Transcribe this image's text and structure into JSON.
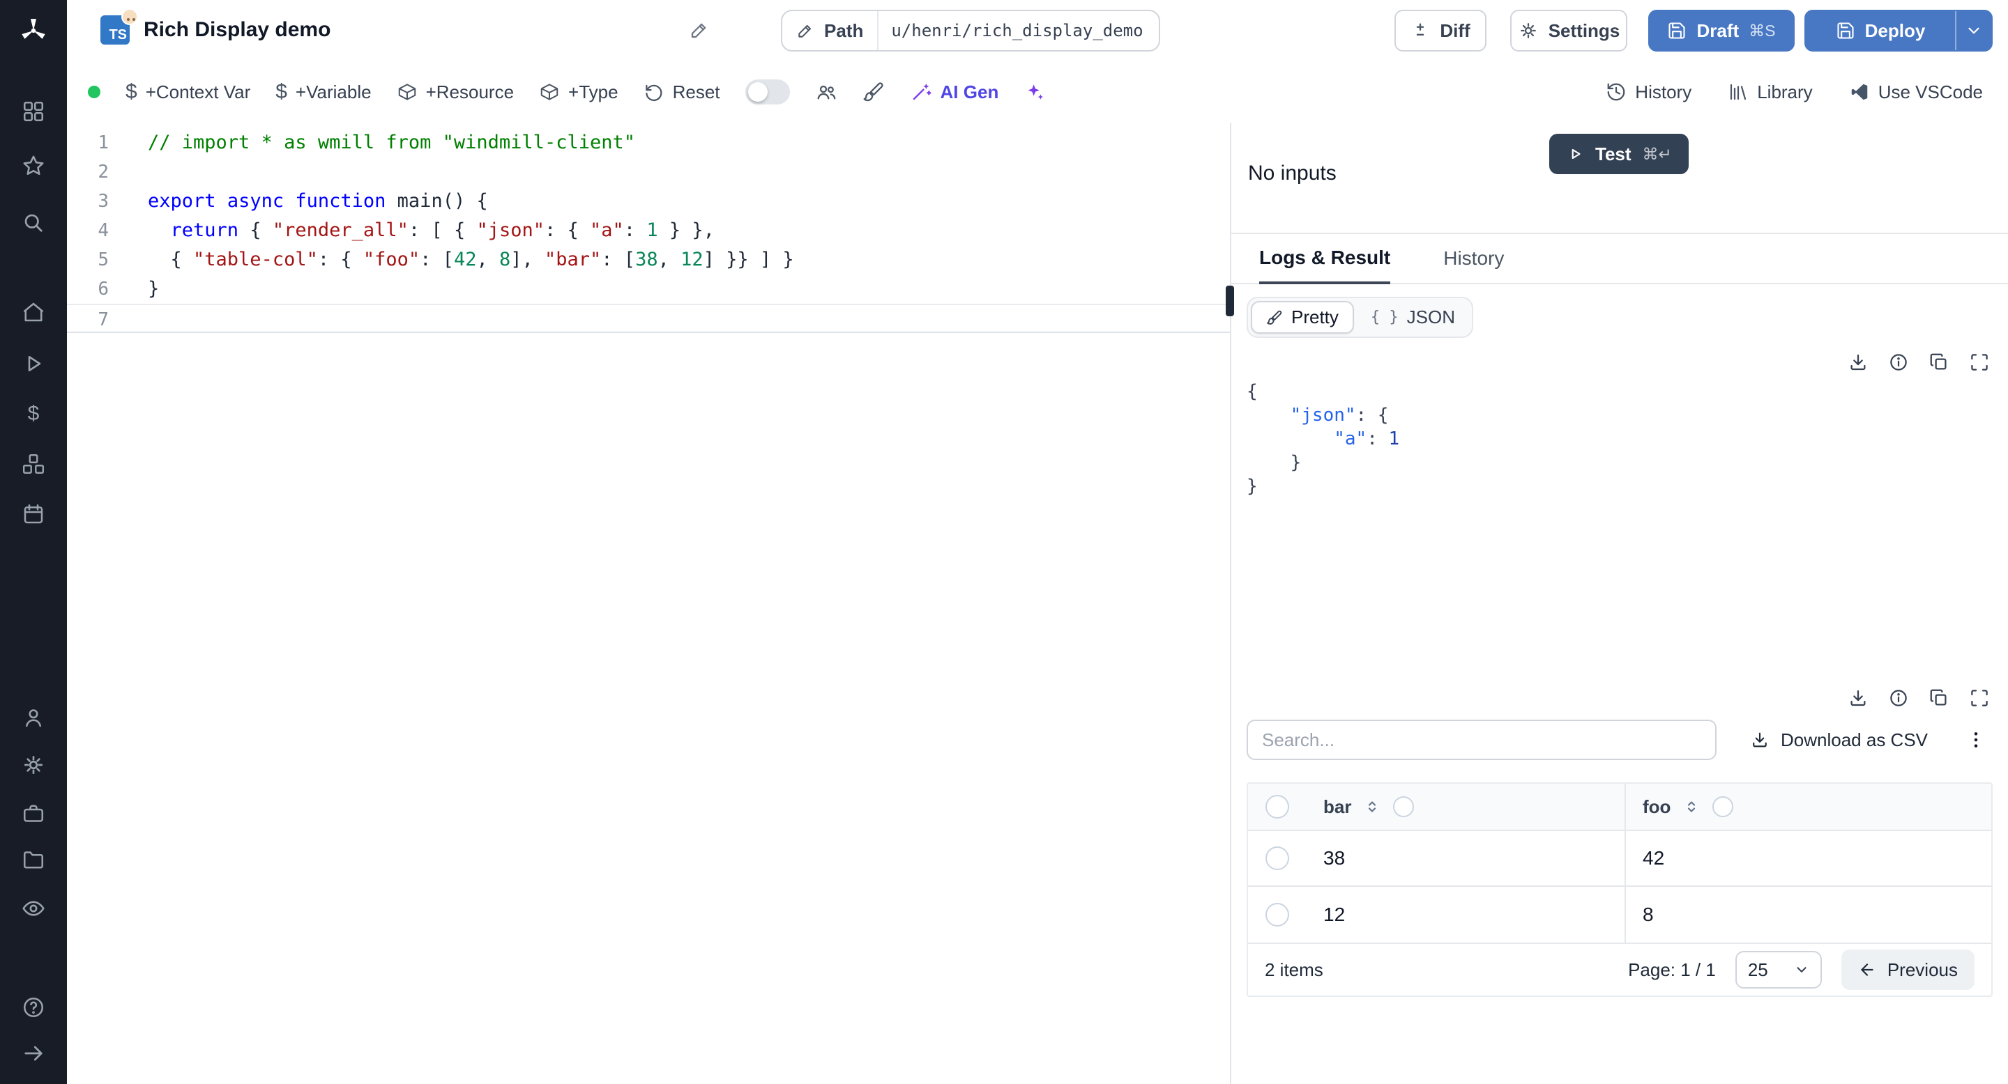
{
  "colors": {
    "primary_button": "#4878c4",
    "sidebar_bg": "#171c26",
    "status_dot": "#22c55e",
    "ai_accent": "#7c3aed",
    "ts_badge": "#3178c6",
    "test_button": "#334155"
  },
  "sidebar": {
    "icons": [
      "windmill-logo",
      "workspace-apps",
      "favorites-star",
      "search",
      "home",
      "runs-play",
      "variables-dollar",
      "resources-boxes",
      "schedules-calendar",
      "users",
      "settings-gear",
      "workers-briefcase",
      "folders",
      "audit-eye",
      "help",
      "collapse-arrow"
    ]
  },
  "header": {
    "language_badge": "TS",
    "title": "Rich Display demo",
    "path_button": "Path",
    "path_value": "u/henri/rich_display_demo",
    "diff_button": "Diff",
    "settings_button": "Settings",
    "draft_button": "Draft",
    "draft_shortcut": "⌘S",
    "deploy_button": "Deploy"
  },
  "toolbar": {
    "context_var": "+Context Var",
    "variable": "+Variable",
    "resource": "+Resource",
    "type": "+Type",
    "reset": "Reset",
    "ai_gen": "AI Gen",
    "history": "History",
    "library": "Library",
    "vscode": "Use VSCode"
  },
  "editor": {
    "lines": [
      {
        "n": 1,
        "parts": [
          {
            "t": "// import * as wmill from \"windmill-client\"",
            "c": "comment"
          }
        ]
      },
      {
        "n": 2,
        "parts": []
      },
      {
        "n": 3,
        "parts": [
          {
            "t": "export",
            "c": "kw"
          },
          {
            "t": " ",
            "c": "pln"
          },
          {
            "t": "async",
            "c": "kw"
          },
          {
            "t": " ",
            "c": "pln"
          },
          {
            "t": "function",
            "c": "kw"
          },
          {
            "t": " ",
            "c": "pln"
          },
          {
            "t": "main",
            "c": "fn"
          },
          {
            "t": "() {",
            "c": "pln"
          }
        ]
      },
      {
        "n": 4,
        "parts": [
          {
            "t": "  ",
            "c": "pln"
          },
          {
            "t": "return",
            "c": "kw"
          },
          {
            "t": " { ",
            "c": "pln"
          },
          {
            "t": "\"render_all\"",
            "c": "str"
          },
          {
            "t": ": [ { ",
            "c": "pln"
          },
          {
            "t": "\"json\"",
            "c": "str"
          },
          {
            "t": ": { ",
            "c": "pln"
          },
          {
            "t": "\"a\"",
            "c": "str"
          },
          {
            "t": ": ",
            "c": "pln"
          },
          {
            "t": "1",
            "c": "num"
          },
          {
            "t": " } },",
            "c": "pln"
          }
        ]
      },
      {
        "n": 5,
        "parts": [
          {
            "t": "  { ",
            "c": "pln"
          },
          {
            "t": "\"table-col\"",
            "c": "str"
          },
          {
            "t": ": { ",
            "c": "pln"
          },
          {
            "t": "\"foo\"",
            "c": "str"
          },
          {
            "t": ": [",
            "c": "pln"
          },
          {
            "t": "42",
            "c": "num"
          },
          {
            "t": ", ",
            "c": "pln"
          },
          {
            "t": "8",
            "c": "num"
          },
          {
            "t": "], ",
            "c": "pln"
          },
          {
            "t": "\"bar\"",
            "c": "str"
          },
          {
            "t": ": [",
            "c": "pln"
          },
          {
            "t": "38",
            "c": "num"
          },
          {
            "t": ", ",
            "c": "pln"
          },
          {
            "t": "12",
            "c": "num"
          },
          {
            "t": "] }} ] }",
            "c": "pln"
          }
        ]
      },
      {
        "n": 6,
        "parts": [
          {
            "t": "}",
            "c": "pln"
          }
        ]
      },
      {
        "n": 7,
        "parts": [],
        "current": true
      }
    ]
  },
  "preview": {
    "no_inputs": "No inputs",
    "test_button": "Test",
    "test_shortcut": "⌘↵",
    "tabs": [
      {
        "label": "Logs & Result",
        "active": true
      },
      {
        "label": "History",
        "active": false
      }
    ],
    "view_modes": [
      {
        "label": "Pretty",
        "active": true
      },
      {
        "label": "JSON",
        "active": false
      }
    ],
    "json_result": {
      "lines": [
        [
          {
            "t": "{",
            "c": "pun"
          }
        ],
        [
          {
            "t": "    ",
            "c": "pun"
          },
          {
            "t": "\"json\"",
            "c": "key"
          },
          {
            "t": ": {",
            "c": "pun"
          }
        ],
        [
          {
            "t": "        ",
            "c": "pun"
          },
          {
            "t": "\"a\"",
            "c": "key"
          },
          {
            "t": ": ",
            "c": "pun"
          },
          {
            "t": "1",
            "c": "num"
          }
        ],
        [
          {
            "t": "    }",
            "c": "pun"
          }
        ],
        [
          {
            "t": "}",
            "c": "pun"
          }
        ]
      ]
    },
    "table": {
      "search_placeholder": "Search...",
      "download_csv": "Download as CSV",
      "columns": [
        "bar",
        "foo"
      ],
      "rows": [
        [
          "38",
          "42"
        ],
        [
          "12",
          "8"
        ]
      ],
      "items_count": "2 items",
      "page_label": "Page: 1 / 1",
      "page_size": "25",
      "previous_button": "Previous"
    }
  }
}
